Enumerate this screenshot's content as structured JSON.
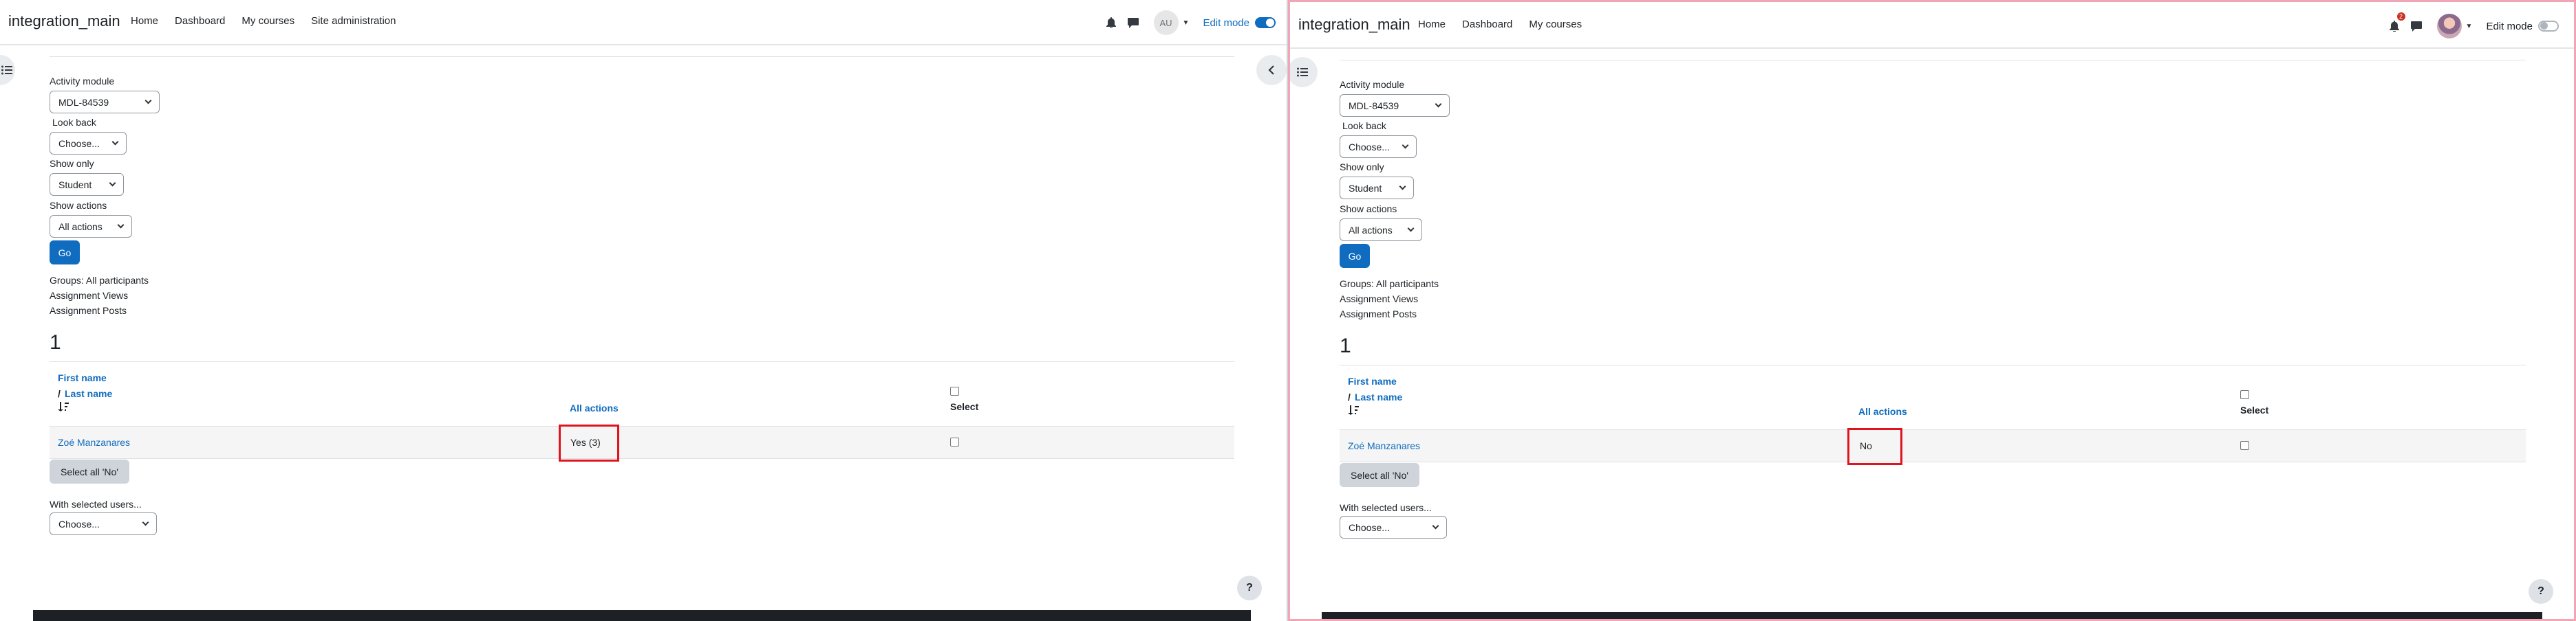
{
  "panels": [
    {
      "brand": "integration_main",
      "nav": [
        "Home",
        "Dashboard",
        "My courses",
        "Site administration"
      ],
      "avatar_initials": "AU",
      "notification_count": "",
      "edit_mode_label": "Edit mode",
      "edit_mode_on": true,
      "form": {
        "activity_module_label": "Activity module",
        "activity_module_value": "MDL-84539",
        "look_back_label": "Look back",
        "look_back_value": "Choose...",
        "show_only_label": "Show only",
        "show_only_value": "Student",
        "show_actions_label": "Show actions",
        "show_actions_value": "All actions",
        "go_label": "Go"
      },
      "info": [
        "Groups: All participants",
        "Assignment Views",
        "Assignment Posts"
      ],
      "count": "1",
      "table": {
        "first_name": "First name",
        "slash": "/",
        "last_name": "Last name",
        "all_actions": "All actions",
        "select": "Select",
        "row_name": "Zoé Manzanares",
        "row_value": "Yes (3)"
      },
      "select_all_label": "Select all 'No'",
      "with_selected_label": "With selected users...",
      "with_selected_value": "Choose...",
      "help": "?"
    },
    {
      "brand": "integration_main",
      "nav": [
        "Home",
        "Dashboard",
        "My courses"
      ],
      "avatar_initials": "",
      "notification_count": "2",
      "edit_mode_label": "Edit mode",
      "edit_mode_on": false,
      "form": {
        "activity_module_label": "Activity module",
        "activity_module_value": "MDL-84539",
        "look_back_label": "Look back",
        "look_back_value": "Choose...",
        "show_only_label": "Show only",
        "show_only_value": "Student",
        "show_actions_label": "Show actions",
        "show_actions_value": "All actions",
        "go_label": "Go"
      },
      "info": [
        "Groups: All participants",
        "Assignment Views",
        "Assignment Posts"
      ],
      "count": "1",
      "table": {
        "first_name": "First name",
        "slash": "/",
        "last_name": "Last name",
        "all_actions": "All actions",
        "select": "Select",
        "row_name": "Zoé Manzanares",
        "row_value": "No"
      },
      "select_all_label": "Select all 'No'",
      "with_selected_label": "With selected users...",
      "with_selected_value": "Choose...",
      "help": "?"
    }
  ],
  "colors": {
    "primary": "#0f6cbf",
    "highlight": "#e0141e",
    "badge": "#ca3120"
  },
  "icons": [
    "bell-icon",
    "chat-icon",
    "drawer-index-icon",
    "chevron-left-icon",
    "sort-icon"
  ]
}
